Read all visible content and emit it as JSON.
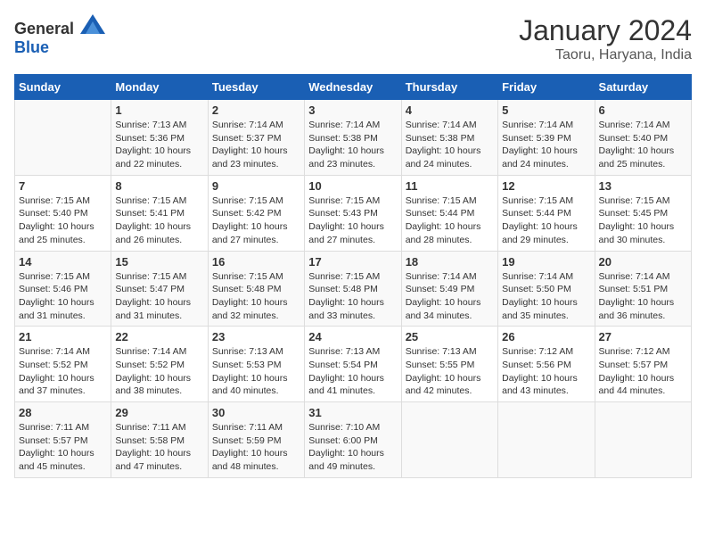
{
  "header": {
    "logo": {
      "text_general": "General",
      "text_blue": "Blue"
    },
    "title": "January 2024",
    "subtitle": "Taoru, Haryana, India"
  },
  "days_of_week": [
    "Sunday",
    "Monday",
    "Tuesday",
    "Wednesday",
    "Thursday",
    "Friday",
    "Saturday"
  ],
  "weeks": [
    {
      "cells": [
        {
          "day": "",
          "sunrise": "",
          "sunset": "",
          "daylight": ""
        },
        {
          "day": "1",
          "sunrise": "Sunrise: 7:13 AM",
          "sunset": "Sunset: 5:36 PM",
          "daylight": "Daylight: 10 hours and 22 minutes."
        },
        {
          "day": "2",
          "sunrise": "Sunrise: 7:14 AM",
          "sunset": "Sunset: 5:37 PM",
          "daylight": "Daylight: 10 hours and 23 minutes."
        },
        {
          "day": "3",
          "sunrise": "Sunrise: 7:14 AM",
          "sunset": "Sunset: 5:38 PM",
          "daylight": "Daylight: 10 hours and 23 minutes."
        },
        {
          "day": "4",
          "sunrise": "Sunrise: 7:14 AM",
          "sunset": "Sunset: 5:38 PM",
          "daylight": "Daylight: 10 hours and 24 minutes."
        },
        {
          "day": "5",
          "sunrise": "Sunrise: 7:14 AM",
          "sunset": "Sunset: 5:39 PM",
          "daylight": "Daylight: 10 hours and 24 minutes."
        },
        {
          "day": "6",
          "sunrise": "Sunrise: 7:14 AM",
          "sunset": "Sunset: 5:40 PM",
          "daylight": "Daylight: 10 hours and 25 minutes."
        }
      ]
    },
    {
      "cells": [
        {
          "day": "7",
          "sunrise": "Sunrise: 7:15 AM",
          "sunset": "Sunset: 5:40 PM",
          "daylight": "Daylight: 10 hours and 25 minutes."
        },
        {
          "day": "8",
          "sunrise": "Sunrise: 7:15 AM",
          "sunset": "Sunset: 5:41 PM",
          "daylight": "Daylight: 10 hours and 26 minutes."
        },
        {
          "day": "9",
          "sunrise": "Sunrise: 7:15 AM",
          "sunset": "Sunset: 5:42 PM",
          "daylight": "Daylight: 10 hours and 27 minutes."
        },
        {
          "day": "10",
          "sunrise": "Sunrise: 7:15 AM",
          "sunset": "Sunset: 5:43 PM",
          "daylight": "Daylight: 10 hours and 27 minutes."
        },
        {
          "day": "11",
          "sunrise": "Sunrise: 7:15 AM",
          "sunset": "Sunset: 5:44 PM",
          "daylight": "Daylight: 10 hours and 28 minutes."
        },
        {
          "day": "12",
          "sunrise": "Sunrise: 7:15 AM",
          "sunset": "Sunset: 5:44 PM",
          "daylight": "Daylight: 10 hours and 29 minutes."
        },
        {
          "day": "13",
          "sunrise": "Sunrise: 7:15 AM",
          "sunset": "Sunset: 5:45 PM",
          "daylight": "Daylight: 10 hours and 30 minutes."
        }
      ]
    },
    {
      "cells": [
        {
          "day": "14",
          "sunrise": "Sunrise: 7:15 AM",
          "sunset": "Sunset: 5:46 PM",
          "daylight": "Daylight: 10 hours and 31 minutes."
        },
        {
          "day": "15",
          "sunrise": "Sunrise: 7:15 AM",
          "sunset": "Sunset: 5:47 PM",
          "daylight": "Daylight: 10 hours and 31 minutes."
        },
        {
          "day": "16",
          "sunrise": "Sunrise: 7:15 AM",
          "sunset": "Sunset: 5:48 PM",
          "daylight": "Daylight: 10 hours and 32 minutes."
        },
        {
          "day": "17",
          "sunrise": "Sunrise: 7:15 AM",
          "sunset": "Sunset: 5:48 PM",
          "daylight": "Daylight: 10 hours and 33 minutes."
        },
        {
          "day": "18",
          "sunrise": "Sunrise: 7:14 AM",
          "sunset": "Sunset: 5:49 PM",
          "daylight": "Daylight: 10 hours and 34 minutes."
        },
        {
          "day": "19",
          "sunrise": "Sunrise: 7:14 AM",
          "sunset": "Sunset: 5:50 PM",
          "daylight": "Daylight: 10 hours and 35 minutes."
        },
        {
          "day": "20",
          "sunrise": "Sunrise: 7:14 AM",
          "sunset": "Sunset: 5:51 PM",
          "daylight": "Daylight: 10 hours and 36 minutes."
        }
      ]
    },
    {
      "cells": [
        {
          "day": "21",
          "sunrise": "Sunrise: 7:14 AM",
          "sunset": "Sunset: 5:52 PM",
          "daylight": "Daylight: 10 hours and 37 minutes."
        },
        {
          "day": "22",
          "sunrise": "Sunrise: 7:14 AM",
          "sunset": "Sunset: 5:52 PM",
          "daylight": "Daylight: 10 hours and 38 minutes."
        },
        {
          "day": "23",
          "sunrise": "Sunrise: 7:13 AM",
          "sunset": "Sunset: 5:53 PM",
          "daylight": "Daylight: 10 hours and 40 minutes."
        },
        {
          "day": "24",
          "sunrise": "Sunrise: 7:13 AM",
          "sunset": "Sunset: 5:54 PM",
          "daylight": "Daylight: 10 hours and 41 minutes."
        },
        {
          "day": "25",
          "sunrise": "Sunrise: 7:13 AM",
          "sunset": "Sunset: 5:55 PM",
          "daylight": "Daylight: 10 hours and 42 minutes."
        },
        {
          "day": "26",
          "sunrise": "Sunrise: 7:12 AM",
          "sunset": "Sunset: 5:56 PM",
          "daylight": "Daylight: 10 hours and 43 minutes."
        },
        {
          "day": "27",
          "sunrise": "Sunrise: 7:12 AM",
          "sunset": "Sunset: 5:57 PM",
          "daylight": "Daylight: 10 hours and 44 minutes."
        }
      ]
    },
    {
      "cells": [
        {
          "day": "28",
          "sunrise": "Sunrise: 7:11 AM",
          "sunset": "Sunset: 5:57 PM",
          "daylight": "Daylight: 10 hours and 45 minutes."
        },
        {
          "day": "29",
          "sunrise": "Sunrise: 7:11 AM",
          "sunset": "Sunset: 5:58 PM",
          "daylight": "Daylight: 10 hours and 47 minutes."
        },
        {
          "day": "30",
          "sunrise": "Sunrise: 7:11 AM",
          "sunset": "Sunset: 5:59 PM",
          "daylight": "Daylight: 10 hours and 48 minutes."
        },
        {
          "day": "31",
          "sunrise": "Sunrise: 7:10 AM",
          "sunset": "Sunset: 6:00 PM",
          "daylight": "Daylight: 10 hours and 49 minutes."
        },
        {
          "day": "",
          "sunrise": "",
          "sunset": "",
          "daylight": ""
        },
        {
          "day": "",
          "sunrise": "",
          "sunset": "",
          "daylight": ""
        },
        {
          "day": "",
          "sunrise": "",
          "sunset": "",
          "daylight": ""
        }
      ]
    }
  ]
}
